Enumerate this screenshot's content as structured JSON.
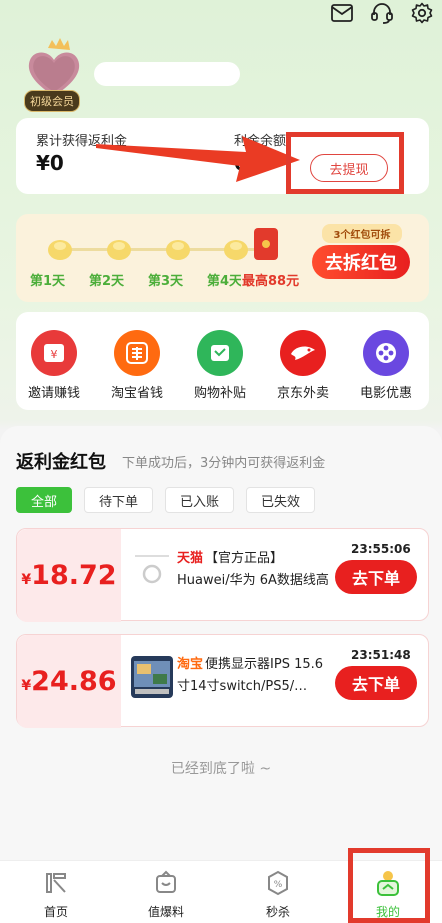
{
  "header": {
    "icons": [
      "mail-icon",
      "headset-icon",
      "settings-icon"
    ]
  },
  "profile": {
    "badge": "初级会员"
  },
  "rebate_card": {
    "total_label": "累计获得返利金",
    "total_value": "¥0",
    "balance_label_visible": "利金余额",
    "balance_value_visible": "0",
    "withdraw_button": "去提现"
  },
  "checkin": {
    "days": [
      "第1天",
      "第2天",
      "第3天",
      "第4天"
    ],
    "max_reward": "最高88元",
    "split_tag": "3个红包可拆",
    "split_button": "去拆红包"
  },
  "shortcuts": [
    {
      "label": "邀请赚钱",
      "icon": "invite-icon",
      "color": "#e83a3a"
    },
    {
      "label": "淘宝省钱",
      "icon": "taobao-icon",
      "color": "#ff6a10"
    },
    {
      "label": "购物补贴",
      "icon": "ticket-icon",
      "color": "#2fb65a"
    },
    {
      "label": "京东外卖",
      "icon": "jd-takeout-icon",
      "color": "#e8201f"
    },
    {
      "label": "电影优惠",
      "icon": "film-icon",
      "color": "#6a48e0"
    }
  ],
  "rebate_section": {
    "title": "返利金红包",
    "subtitle": "下单成功后，3分钟内可获得返利金",
    "tabs": [
      "全部",
      "待下单",
      "已入账",
      "已失效"
    ],
    "active_tab": "全部"
  },
  "orders": [
    {
      "yen": "¥",
      "amount": "18.72",
      "shop": "天猫",
      "title": "【官方正品】Huawei/华为 6A数据线高品…",
      "time": "23:55:06",
      "button": "去下单",
      "shop_color": "#e8201f"
    },
    {
      "yen": "¥",
      "amount": "24.86",
      "shop": "淘宝",
      "title": "便携显示器IPS 15.6寸14寸switch/PS5/…",
      "time": "23:51:48",
      "button": "去下单",
      "shop_color": "#ff6a10"
    }
  ],
  "bottom_note": "已经到底了啦 ~",
  "navbar": [
    {
      "label": "首页",
      "icon": "home-icon"
    },
    {
      "label": "值爆料",
      "icon": "deals-icon"
    },
    {
      "label": "秒杀",
      "icon": "flash-sale-icon"
    },
    {
      "label": "我的",
      "icon": "profile-icon"
    }
  ],
  "colors": {
    "accent_green": "#3cc13b",
    "accent_red": "#e8201f",
    "highlight_frame": "#e23a2c"
  }
}
